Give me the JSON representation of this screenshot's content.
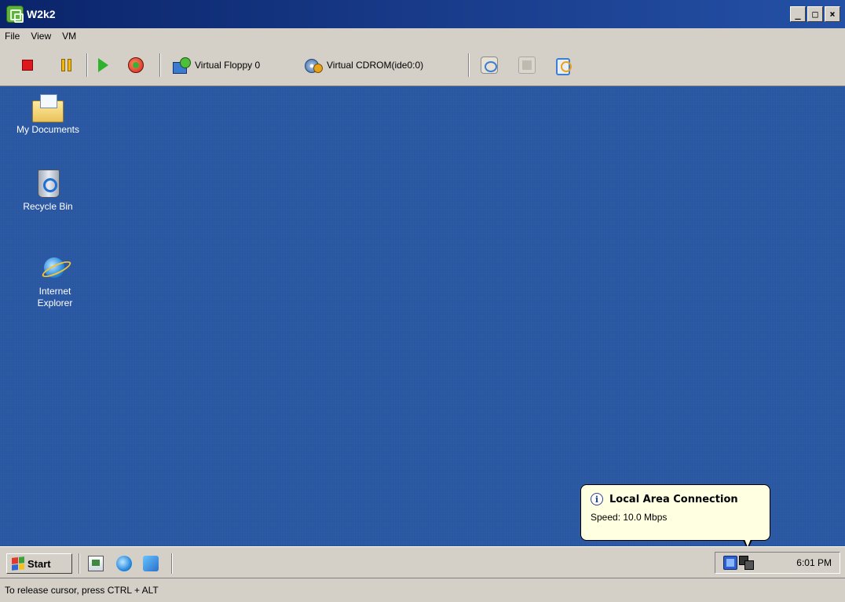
{
  "window": {
    "title": "W2k2",
    "controls": {
      "minimize": "_",
      "maximize": "□",
      "close": "×"
    }
  },
  "menu": [
    "File",
    "View",
    "VM"
  ],
  "toolbar": {
    "icons": [
      "stop-icon",
      "pause-icon",
      "play-icon",
      "reset-icon",
      "floppy-icon",
      "cdrom-icon",
      "snapshot-icon",
      "revert-icon",
      "snapshot-manager-icon"
    ],
    "floppy_label": "Virtual Floppy 0",
    "cdrom_label": "Virtual CDROM(ide0:0)"
  },
  "desktop": {
    "background_color": "#2b57a0",
    "icons": [
      {
        "label": "My Documents",
        "icon": "my-documents-icon"
      },
      {
        "label": "Recycle Bin",
        "icon": "recycle-bin-icon"
      },
      {
        "label": "Internet Explorer",
        "icon": "internet-explorer-icon"
      }
    ]
  },
  "balloon": {
    "title": "Local Area Connection",
    "text": "Speed: 10.0 Mbps",
    "icon": "info-icon"
  },
  "taskbar": {
    "start_label": "Start",
    "quick_launch": [
      "show-desktop-icon",
      "internet-explorer-icon",
      "media-icon"
    ],
    "tray_icons": [
      "tray-display-icon",
      "network-connection-icon"
    ],
    "clock": "6:01 PM"
  },
  "status": {
    "text": "To release cursor, press CTRL + ALT"
  }
}
